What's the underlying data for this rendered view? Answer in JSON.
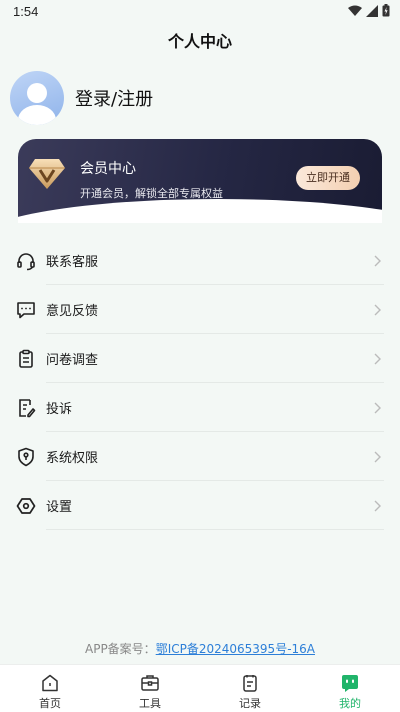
{
  "status_bar": {
    "time": "1:54"
  },
  "header": {
    "title": "个人中心"
  },
  "profile": {
    "login_label": "登录/注册"
  },
  "vip": {
    "title": "会员中心",
    "subtitle": "开通会员，解锁全部专属权益",
    "button_label": "立即开通"
  },
  "menu": {
    "items": [
      {
        "label": "联系客服",
        "icon": "headset-icon"
      },
      {
        "label": "意见反馈",
        "icon": "feedback-icon"
      },
      {
        "label": "问卷调查",
        "icon": "clipboard-icon"
      },
      {
        "label": "投诉",
        "icon": "complaint-icon"
      },
      {
        "label": "系统权限",
        "icon": "shield-icon"
      },
      {
        "label": "设置",
        "icon": "settings-icon"
      }
    ]
  },
  "footer": {
    "icp_prefix": "APP备案号：",
    "icp_link": "鄂ICP备2024065395号-16A"
  },
  "tabbar": {
    "tabs": [
      {
        "label": "首页",
        "icon": "home-icon"
      },
      {
        "label": "工具",
        "icon": "toolbox-icon"
      },
      {
        "label": "记录",
        "icon": "notepad-icon"
      },
      {
        "label": "我的",
        "icon": "profile-face-icon",
        "active": true
      }
    ]
  },
  "colors": {
    "accent": "#20b46a",
    "link": "#2d7fd8"
  }
}
